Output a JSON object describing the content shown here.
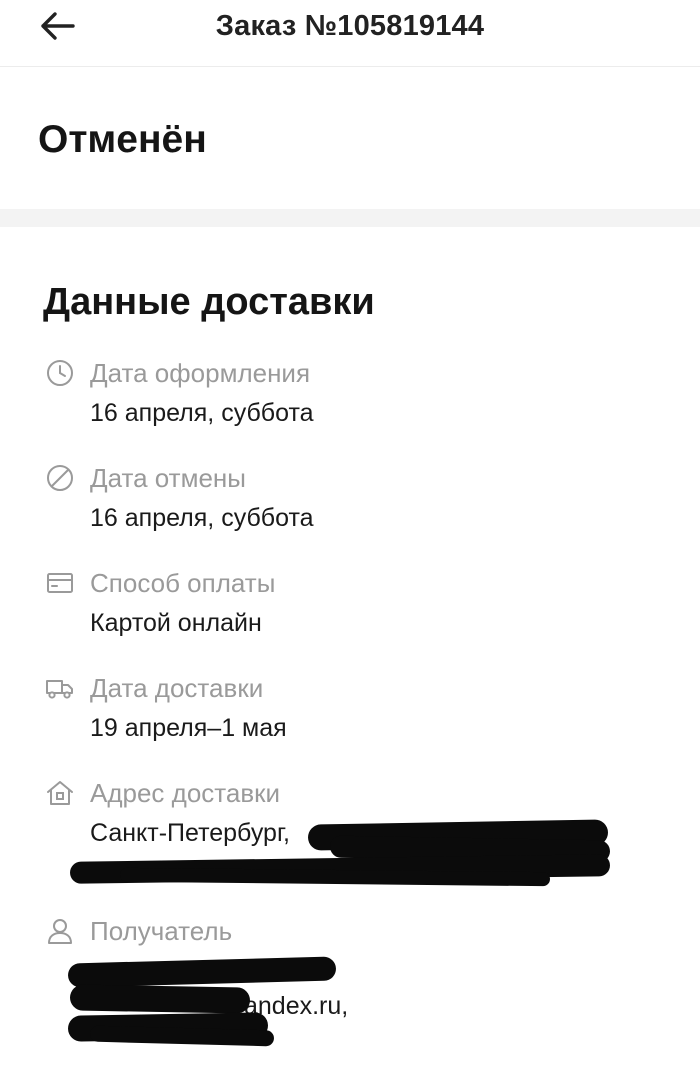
{
  "header": {
    "title": "Заказ №105819144",
    "back_icon": "arrow-left-icon"
  },
  "status": "Отменён",
  "delivery": {
    "section_title": "Данные доставки",
    "fields": [
      {
        "icon": "clock-icon",
        "label": "Дата оформления",
        "value": "16 апреля, суббота"
      },
      {
        "icon": "cancel-circle-icon",
        "label": "Дата отмены",
        "value": "16 апреля, суббота"
      },
      {
        "icon": "card-icon",
        "label": "Способ оплаты",
        "value": "Картой онлайн"
      },
      {
        "icon": "truck-icon",
        "label": "Дата доставки",
        "value": "19 апреля–1 мая"
      },
      {
        "icon": "house-icon",
        "label": "Адрес доставки",
        "value": "Санкт-Петербург,"
      },
      {
        "icon": "person-icon",
        "label": "Получатель",
        "value": "andex.ru,"
      }
    ]
  },
  "colors": {
    "label_gray": "#9a9a9a",
    "separator": "#f3f3f3",
    "redaction": "#0b0b0b"
  }
}
